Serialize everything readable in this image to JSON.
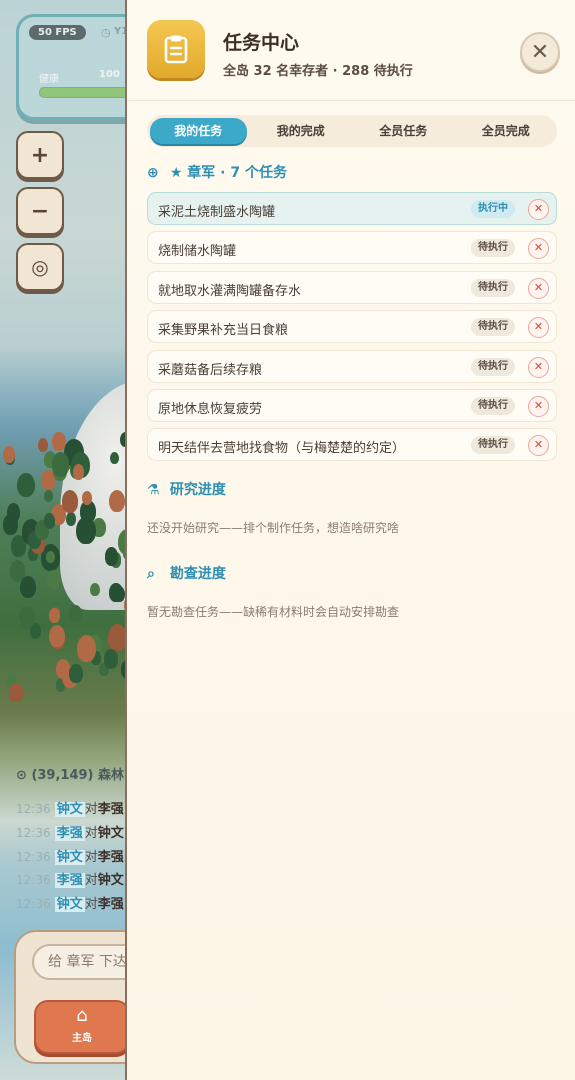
{
  "hud": {
    "fps": "50 FPS",
    "timer": "Y1",
    "health_label": "健康",
    "health_value": "100",
    "health_fraction": 1.0
  },
  "map_controls": {
    "zoom_in": "+",
    "zoom_out": "−",
    "recenter": "◎"
  },
  "location": "(39,149) 森林",
  "event_log": [
    {
      "time": "12:36",
      "a": "钟文",
      "mid": "对",
      "b": "李强"
    },
    {
      "time": "12:36",
      "a": "李强",
      "mid": "对",
      "b": "钟文"
    },
    {
      "time": "12:36",
      "a": "钟文",
      "mid": "对",
      "b": "李强"
    },
    {
      "time": "12:36",
      "a": "李强",
      "mid": "对",
      "b": "钟文"
    },
    {
      "time": "12:36",
      "a": "钟文",
      "mid": "对",
      "b": "李强"
    }
  ],
  "command": {
    "placeholder": "给 章军 下达"
  },
  "bottom_nav": {
    "home_label": "主岛"
  },
  "panel": {
    "title": "任务中心",
    "subtitle": "全岛 32 名幸存者 · 288 待执行",
    "close": "✕",
    "tabs": [
      "我的任务",
      "我的完成",
      "全员任务",
      "全员完成"
    ],
    "active_tab": 0,
    "group_title": "★ 章军 · 7 个任务",
    "tasks": [
      {
        "text": "采泥土烧制盛水陶罐",
        "status": "执行中",
        "running": true
      },
      {
        "text": "烧制储水陶罐",
        "status": "待执行",
        "running": false
      },
      {
        "text": "就地取水灌满陶罐备存水",
        "status": "待执行",
        "running": false
      },
      {
        "text": "采集野果补充当日食粮",
        "status": "待执行",
        "running": false
      },
      {
        "text": "采蘑菇备后续存粮",
        "status": "待执行",
        "running": false
      },
      {
        "text": "原地休息恢复疲劳",
        "status": "待执行",
        "running": false
      },
      {
        "text": "明天结伴去营地找食物（与梅楚楚的约定）",
        "status": "待执行",
        "running": false
      }
    ],
    "research_title": "研究进度",
    "research_empty": "还没开始研究——排个制作任务，想造啥研究啥",
    "survey_title": "勘查进度",
    "survey_empty": "暂无勘查任务——缺稀有材料时会自动安排勘查"
  }
}
